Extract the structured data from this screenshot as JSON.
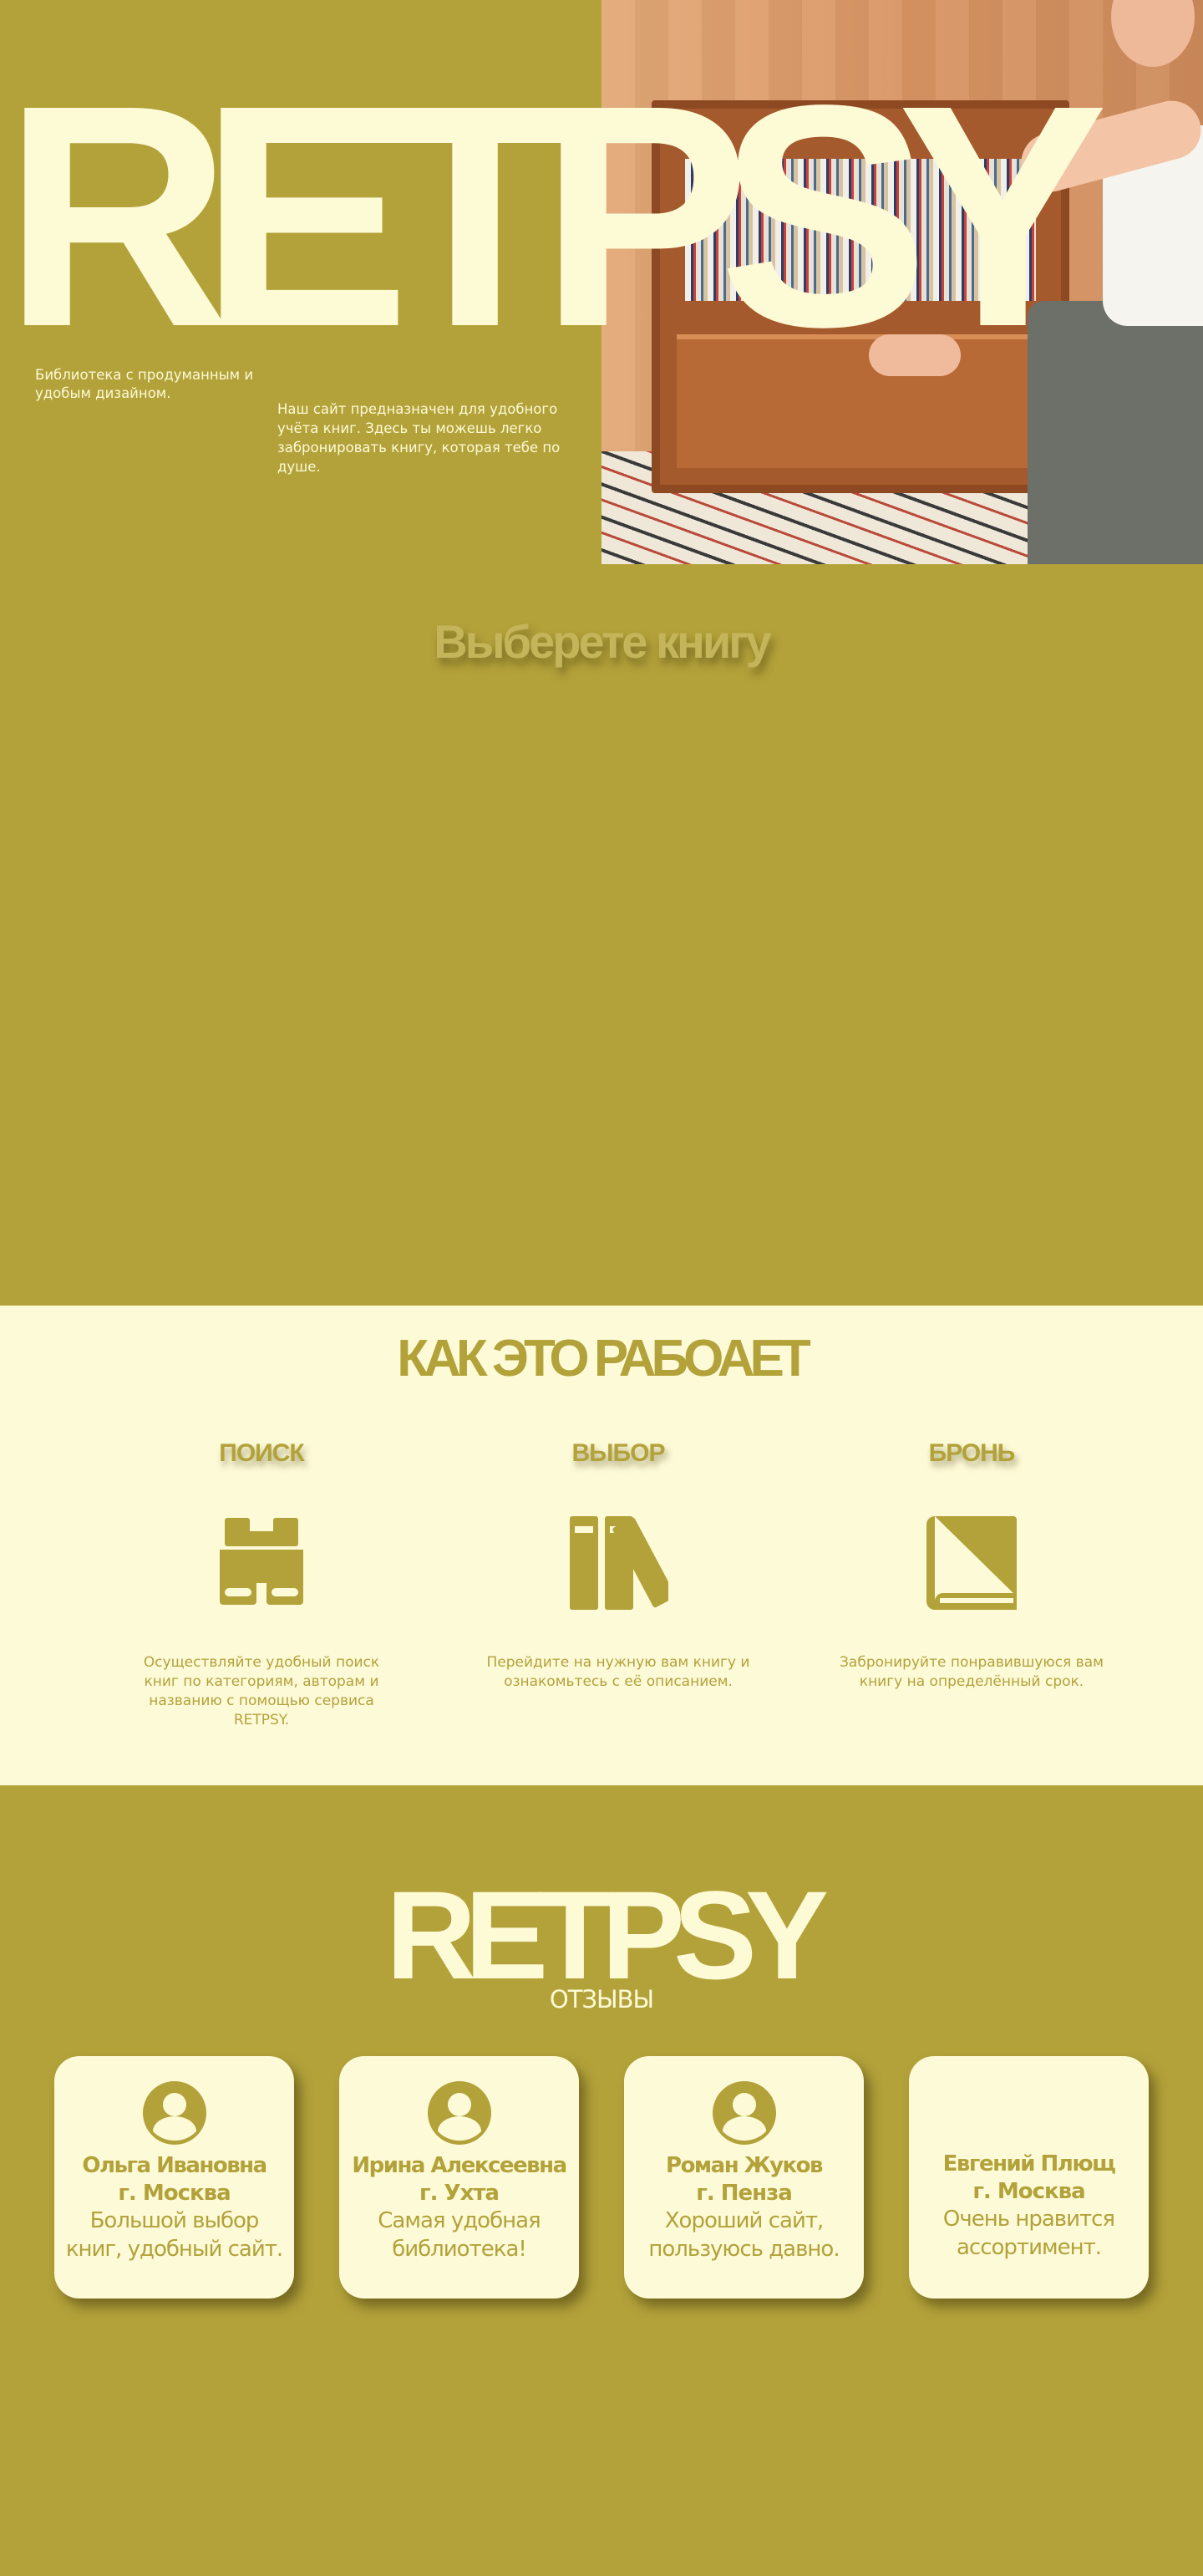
{
  "hero": {
    "logo": "RETPSY",
    "tagline": "Библиотека с продуманным и удобым дизайном.",
    "description": "Наш сайт предназначен для удобного учёта книг.  Здесь ты можешь легко забронировать книгу, которая тебе по душе."
  },
  "choose": {
    "title": "Выберете книгу"
  },
  "how": {
    "title": "КАК ЭТО РАБОАЕТ",
    "steps": [
      {
        "title": "ПОИСК",
        "icon": "binoculars-icon",
        "text": "Осуществляйте  удобный поиск книг по категориям, авторам и названию с помощью сервиса RETPSY."
      },
      {
        "title": "ВЫБОР",
        "icon": "books-icon",
        "text": "Перейдите на нужную вам книгу и ознакомьтесь с её описанием."
      },
      {
        "title": "БРОНЬ",
        "icon": "book-icon",
        "text": "Забронируйте понравившуюся вам книгу на определённый срок."
      }
    ]
  },
  "reviews": {
    "logo": "RETPSY",
    "label": "ОТЗЫВЫ",
    "items": [
      {
        "name": "Ольга Ивановна",
        "city": "г. Москва",
        "text": "Большой выбор книг, удобный сайт."
      },
      {
        "name": "Ирина Алексеевна",
        "city": "г. Ухта",
        "text": "Самая удобная библиотека!"
      },
      {
        "name": "Роман Жуков",
        "city": "г. Пенза",
        "text": "Хороший сайт, пользуюсь давно."
      },
      {
        "name": "Евгений Плющ",
        "city": "г. Москва",
        "text": "Очень нравится ассортимент."
      }
    ]
  },
  "colors": {
    "background": "#b3a23a",
    "cream": "#fdfad8"
  }
}
